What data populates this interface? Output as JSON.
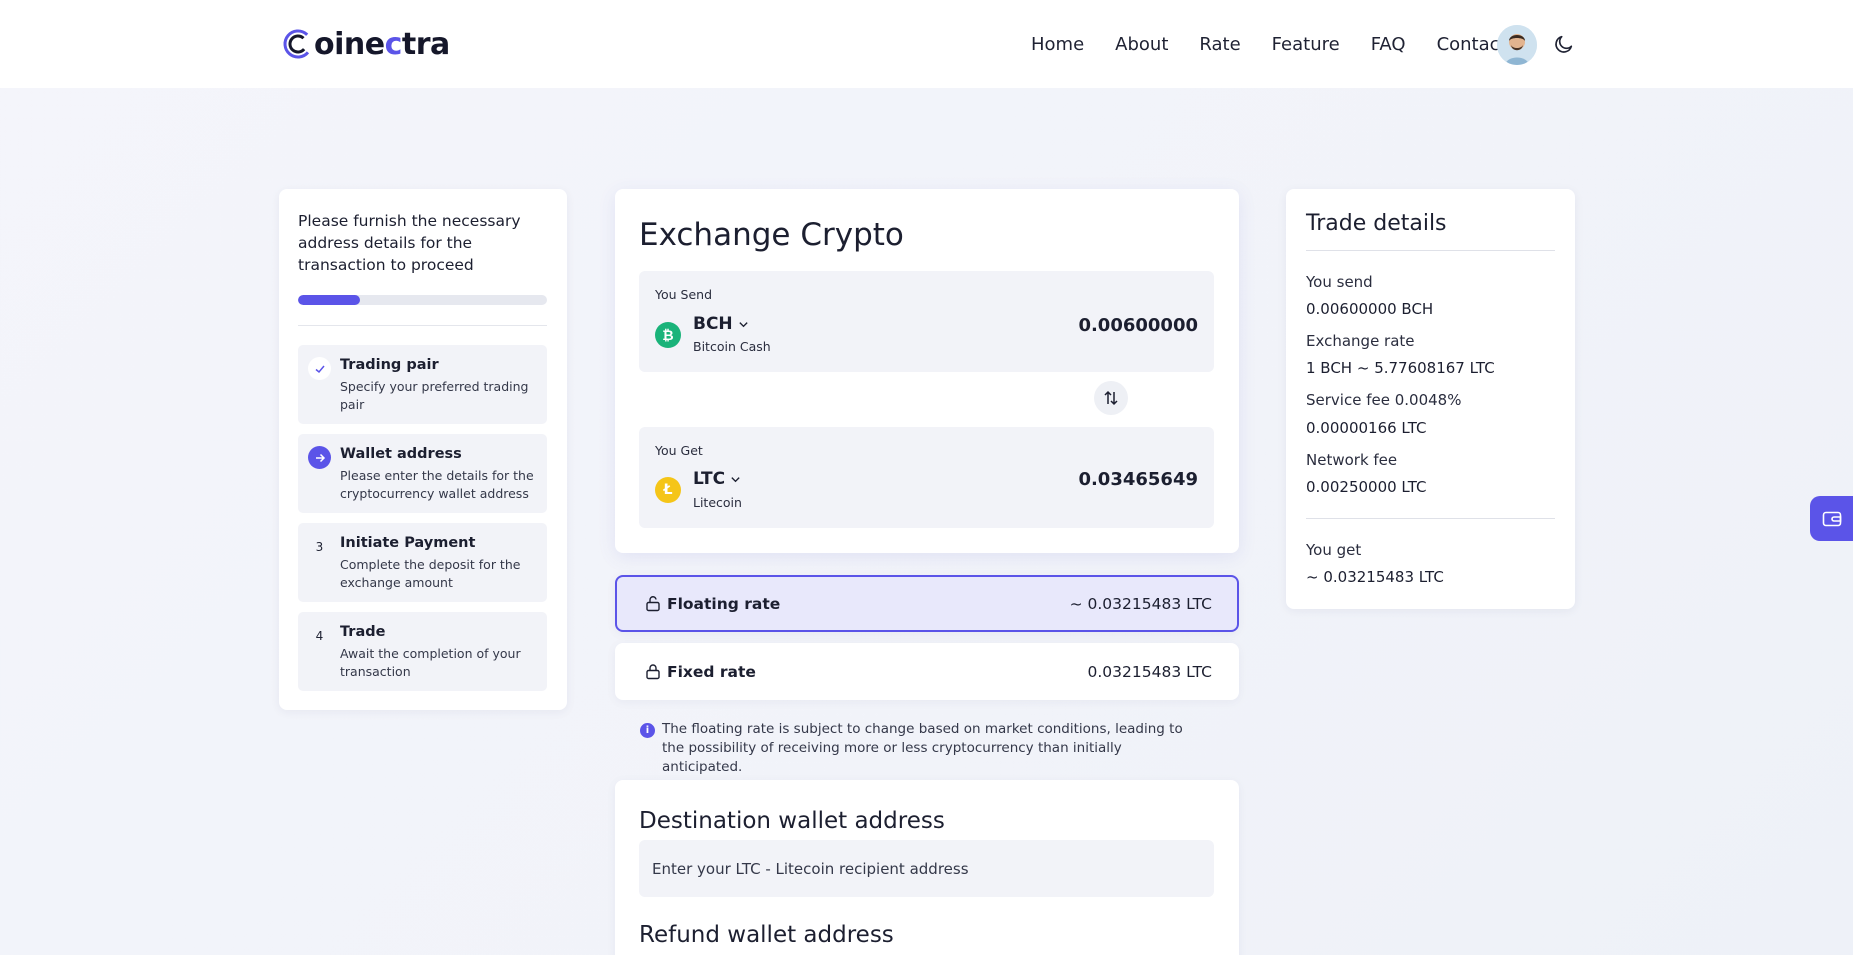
{
  "brand": {
    "name_start": "Coin",
    "name_mid": "e",
    "name_c": "c",
    "name_end": "tra",
    "accent_color": "#5b54e8"
  },
  "nav": {
    "items": [
      {
        "label": "Home"
      },
      {
        "label": "About"
      },
      {
        "label": "Rate"
      },
      {
        "label": "Feature"
      },
      {
        "label": "FAQ"
      },
      {
        "label": "Contact"
      }
    ]
  },
  "steps": {
    "title": "Please furnish the necessary address details for the transaction to proceed",
    "progress_percent": 25,
    "items": [
      {
        "badge": "✓",
        "state": "done",
        "title": "Trading pair",
        "desc": "Specify your preferred trading pair"
      },
      {
        "badge": "→",
        "state": "active",
        "title": "Wallet address",
        "desc": "Please enter the details for the cryptocurrency wallet address"
      },
      {
        "badge": "3",
        "state": "pending",
        "title": "Initiate Payment",
        "desc": "Complete the deposit for the exchange amount"
      },
      {
        "badge": "4",
        "state": "pending",
        "title": "Trade",
        "desc": "Await the completion of your transaction"
      }
    ]
  },
  "exchange": {
    "title": "Exchange Crypto",
    "send": {
      "label": "You Send",
      "ticker": "BCH",
      "name": "Bitcoin Cash",
      "amount": "0.00600000",
      "icon": "bitcoin-cash-icon",
      "color": "#1ab37a"
    },
    "get": {
      "label": "You Get",
      "ticker": "LTC",
      "name": "Litecoin",
      "amount": "0.03465649",
      "icon": "litecoin-icon",
      "color": "#f5c518"
    }
  },
  "rates": {
    "floating": {
      "label": "Floating rate",
      "value": "~ 0.03215483 LTC"
    },
    "fixed": {
      "label": "Fixed rate",
      "value": "0.03215483 LTC"
    },
    "note": "The floating rate is subject to change based on market conditions, leading to the possibility of receiving more or less cryptocurrency than initially anticipated."
  },
  "destination": {
    "title": "Destination wallet address",
    "placeholder": "Enter your LTC - Litecoin recipient address",
    "refund_title": "Refund wallet address"
  },
  "trade": {
    "title": "Trade details",
    "you_send_label": "You send",
    "you_send_value": "0.00600000 BCH",
    "rate_label": "Exchange rate",
    "rate_value": "1 BCH ~ 5.77608167 LTC",
    "service_label": "Service fee 0.0048%",
    "service_value": "0.00000166 LTC",
    "network_label": "Network fee",
    "network_value": "0.00250000 LTC",
    "you_get_label": "You get",
    "you_get_value": "~ 0.03215483 LTC"
  }
}
